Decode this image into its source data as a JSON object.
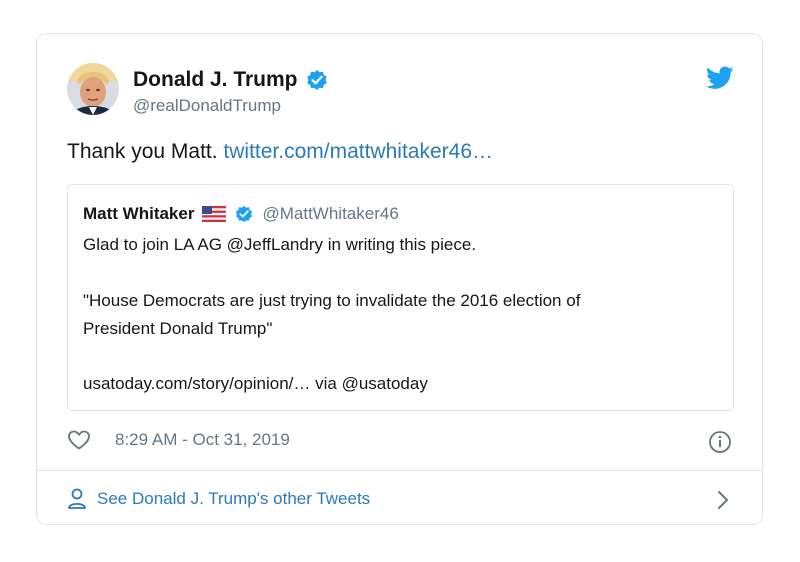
{
  "tweet": {
    "author_name": "Donald J. Trump",
    "author_handle": "@realDonaldTrump",
    "text": "Thank you Matt. ",
    "link_text": "twitter.com/mattwhitaker46…",
    "timestamp": "8:29 AM - Oct 31, 2019"
  },
  "quote": {
    "author_name": "Matt Whitaker",
    "author_handle": "@MattWhitaker46",
    "line1": "Glad to join LA AG @JeffLandry in writing this piece.",
    "line2": "\"House Democrats are just trying to invalidate the 2016 election of",
    "line3": "President Donald Trump\"",
    "line4": " usatoday.com/story/opinion/… via @usatoday"
  },
  "footer": {
    "see_more": "See Donald J. Trump's other Tweets"
  },
  "colors": {
    "twitter_blue": "#1da1f2",
    "link_blue": "#2b7bb9",
    "muted_gray": "#657786",
    "border": "#e1e8ed"
  },
  "icons": [
    "verified-icon",
    "twitter-bird-icon",
    "us-flag-icon",
    "heart-icon",
    "info-icon",
    "person-icon",
    "chevron-right-icon"
  ]
}
